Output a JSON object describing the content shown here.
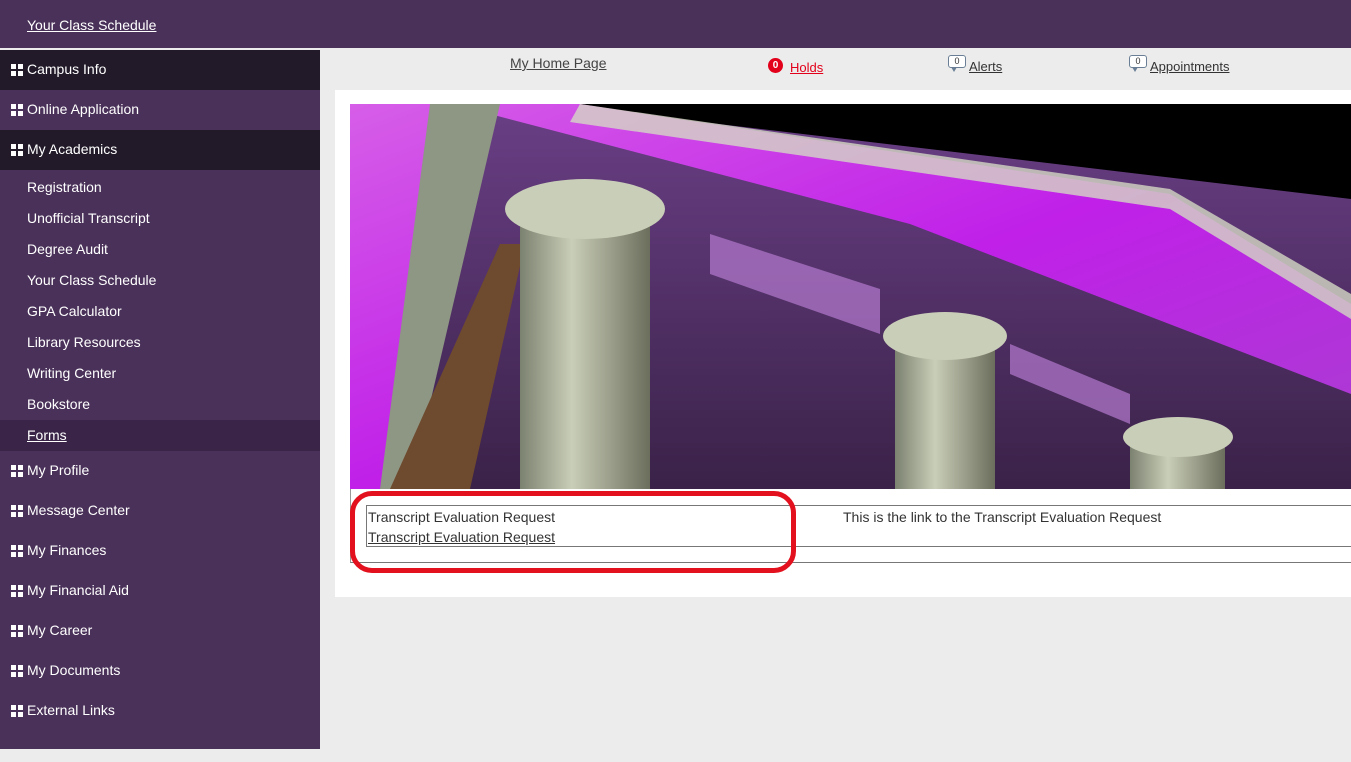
{
  "topbar": {
    "link": "Your Class Schedule"
  },
  "sidebar": {
    "sections_before": [
      {
        "label": "Campus Info"
      },
      {
        "label": "Online Application"
      },
      {
        "label": "My Academics"
      }
    ],
    "academics_items": [
      {
        "label": "Registration"
      },
      {
        "label": "Unofficial Transcript"
      },
      {
        "label": "Degree Audit"
      },
      {
        "label": "Your Class Schedule"
      },
      {
        "label": "GPA Calculator"
      },
      {
        "label": "Library Resources"
      },
      {
        "label": "Writing Center"
      },
      {
        "label": "Bookstore"
      },
      {
        "label": "Forms"
      }
    ],
    "sections_after": [
      {
        "label": "My Profile"
      },
      {
        "label": "Message Center"
      },
      {
        "label": "My Finances"
      },
      {
        "label": "My Financial Aid"
      },
      {
        "label": "My Career"
      },
      {
        "label": "My Documents"
      },
      {
        "label": "External Links"
      }
    ]
  },
  "topnav": {
    "home": "My Home Page",
    "holds_count": "0",
    "holds": "Holds",
    "alerts_count": "0",
    "alerts": "Alerts",
    "appointments_count": "0",
    "appointments": "Appointments"
  },
  "form": {
    "title": "Transcript Evaluation Request",
    "link": "Transcript Evaluation Request",
    "description": "This is the link to the Transcript Evaluation Request"
  },
  "colors": {
    "brand_purple": "#4a3159",
    "dark_section": "#221a29",
    "holds_red": "#e2001a",
    "highlight_red": "#e3101e"
  }
}
